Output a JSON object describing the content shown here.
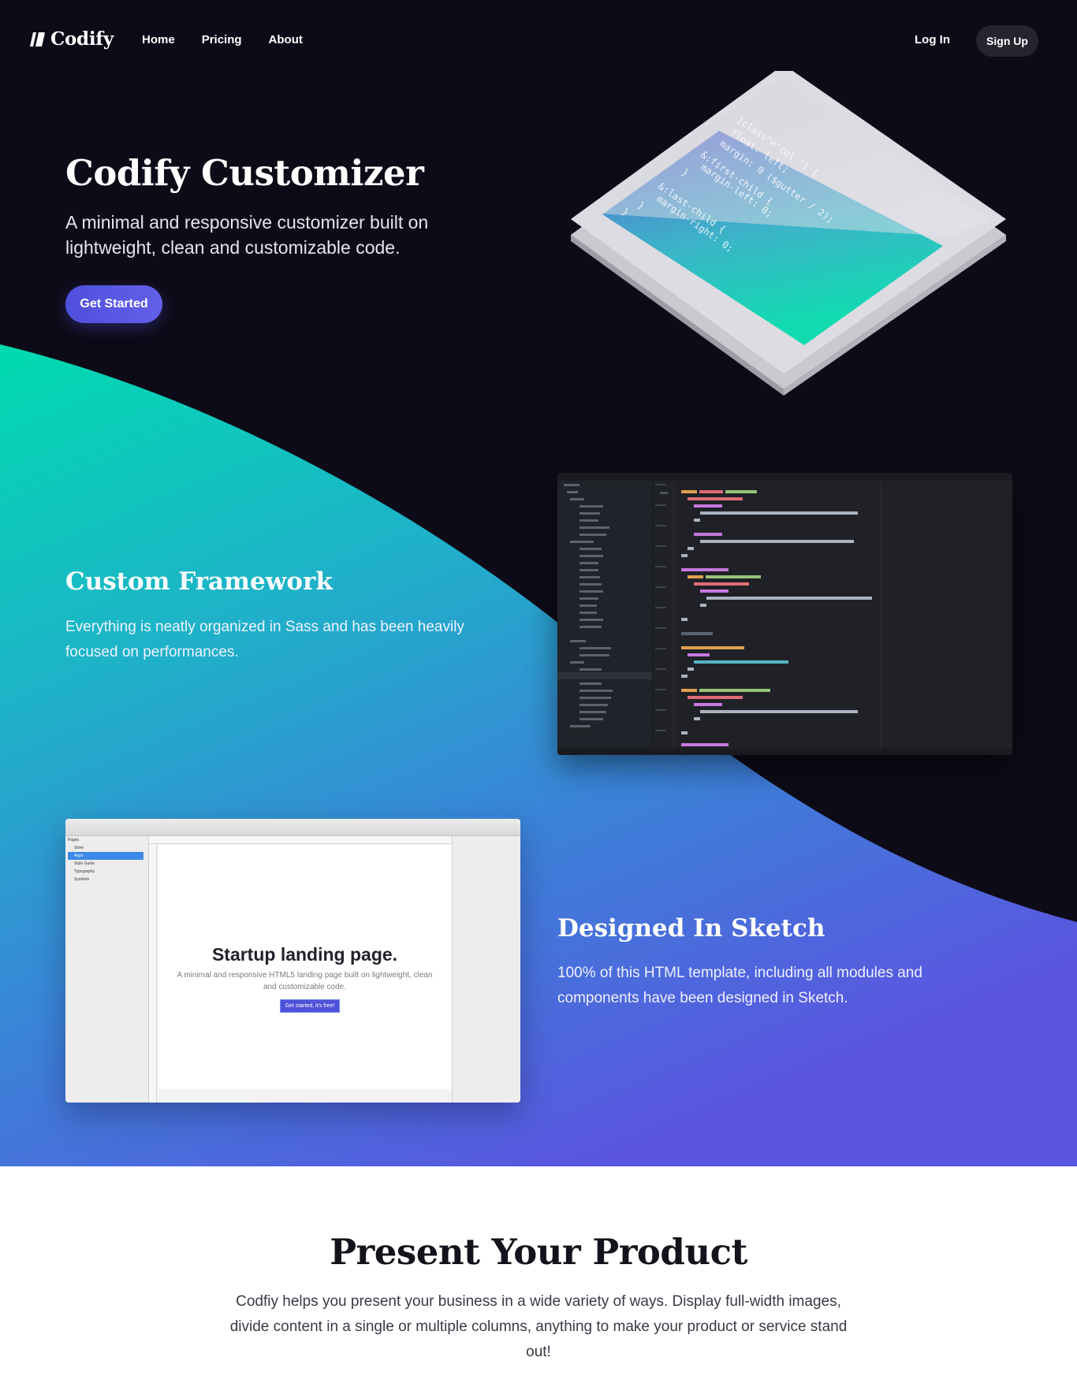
{
  "brand": {
    "name": "Codify"
  },
  "nav": {
    "items": [
      {
        "label": "Home"
      },
      {
        "label": "Pricing"
      },
      {
        "label": "About"
      }
    ],
    "login_label": "Log In",
    "signup_label": "Sign Up"
  },
  "hero": {
    "title": "Codify Customizer",
    "subtitle": "A minimal and responsive customizer built on lightweight, clean and customizable code.",
    "cta_label": "Get Started",
    "code_lines": [
      "[class^=\"col-\"] {",
      "  float: left;",
      "  margin: 0 ($gutter / 2);",
      "  &:first-child {",
      "    margin-left: 0;",
      "  }",
      "  &:last-child {",
      "    margin-right: 0;",
      "  }",
      "}"
    ]
  },
  "feature_framework": {
    "title": "Custom Framework",
    "text": "Everything is neatly organized in Sass and has been heavily focused on performances."
  },
  "feature_sketch": {
    "title": "Designed In Sketch",
    "text": "100% of this HTML template, including all modules and components have been designed in Sketch."
  },
  "sketch_mock": {
    "headline": "Startup landing page.",
    "subline": "A minimal and responsive HTML5 landing page built on lightweight, clean and customizable code.",
    "button_label": "Get started, it's free!",
    "pages_label": "Pages",
    "pages": [
      "Store",
      "Apps",
      "Style Guide",
      "Typography",
      "Symbols"
    ]
  },
  "present": {
    "title": "Present Your Product",
    "text": "Codfiy helps you present your business in a wide variety of ways. Display full-width images, divide content in a single or multiple columns, anything to make your product or service stand out!"
  },
  "colors": {
    "dark_bg": "#0d0b17",
    "wave_start": "#00d8b0",
    "wave_end": "#5b53e0",
    "accent": "#5050dc"
  }
}
